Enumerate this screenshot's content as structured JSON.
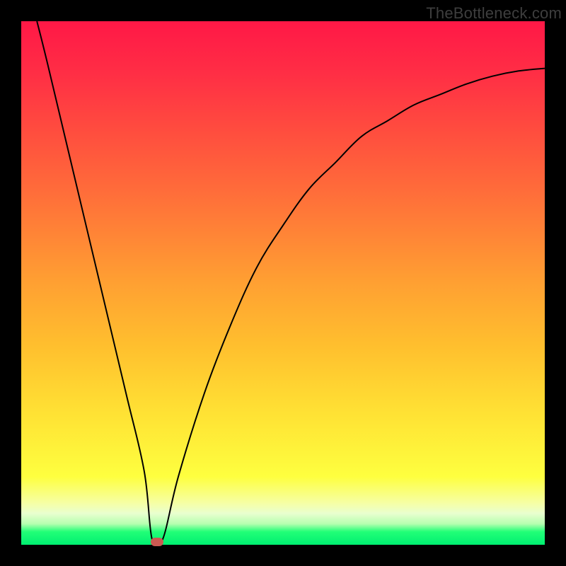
{
  "watermark": "TheBottleneck.com",
  "chart_data": {
    "type": "line",
    "title": "",
    "xlabel": "",
    "ylabel": "",
    "xlim": [
      0,
      100
    ],
    "ylim": [
      0,
      100
    ],
    "grid": false,
    "legend": false,
    "note": "Axes are unlabeled in the image; values are in percent of plot width/height, y measured from bottom.",
    "series": [
      {
        "name": "curve",
        "x": [
          3,
          5,
          10,
          15,
          20,
          23.5,
          25,
          27,
          30,
          35,
          40,
          45,
          50,
          55,
          60,
          65,
          70,
          75,
          80,
          85,
          90,
          95,
          100
        ],
        "y": [
          100,
          92,
          71,
          50,
          29,
          14,
          1,
          1,
          13,
          29,
          42,
          53,
          61,
          68,
          73,
          78,
          81,
          84,
          86,
          88,
          89.5,
          90.5,
          91
        ],
        "stroke": "#000000",
        "stroke_width": 2
      }
    ],
    "markers": [
      {
        "name": "optimum-marker",
        "x": 26,
        "y": 0.5,
        "r": 1.8,
        "color": "#cc5a52"
      }
    ],
    "background_gradient": {
      "direction": "vertical",
      "stops": [
        {
          "pos": 0,
          "color": "#ff1846"
        },
        {
          "pos": 0.5,
          "color": "#ffa032"
        },
        {
          "pos": 0.87,
          "color": "#feff3f"
        },
        {
          "pos": 1.0,
          "color": "#00ef71"
        }
      ]
    }
  }
}
